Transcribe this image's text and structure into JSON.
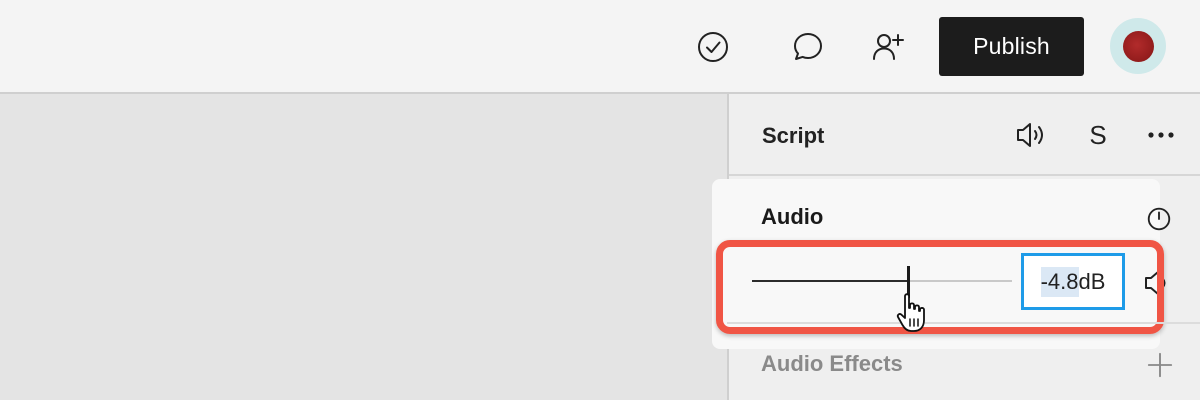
{
  "toolbar": {
    "check_icon": "check-circle-icon",
    "comment_icon": "comment-icon",
    "invite_icon": "user-plus-icon",
    "publish_label": "Publish",
    "publish_color": "#1c1c1c"
  },
  "avatar": {
    "color": "#b22b2b",
    "ring_color": "#cfe9ea"
  },
  "panel": {
    "title": "Script",
    "header_icons": [
      "volume-icon",
      "s-icon",
      "more-icon"
    ],
    "s_label": "S"
  },
  "audio": {
    "title": "Audio",
    "timer_icon": "stopwatch-icon",
    "volume_level": 0.6,
    "value_selected": "-4.8",
    "value_unit": "dB",
    "mute_icon": "speaker-icon",
    "highlight_color": "#f05545",
    "field_border_color": "#1e9be8"
  },
  "effects": {
    "title": "Audio Effects",
    "add_icon": "plus-icon"
  }
}
